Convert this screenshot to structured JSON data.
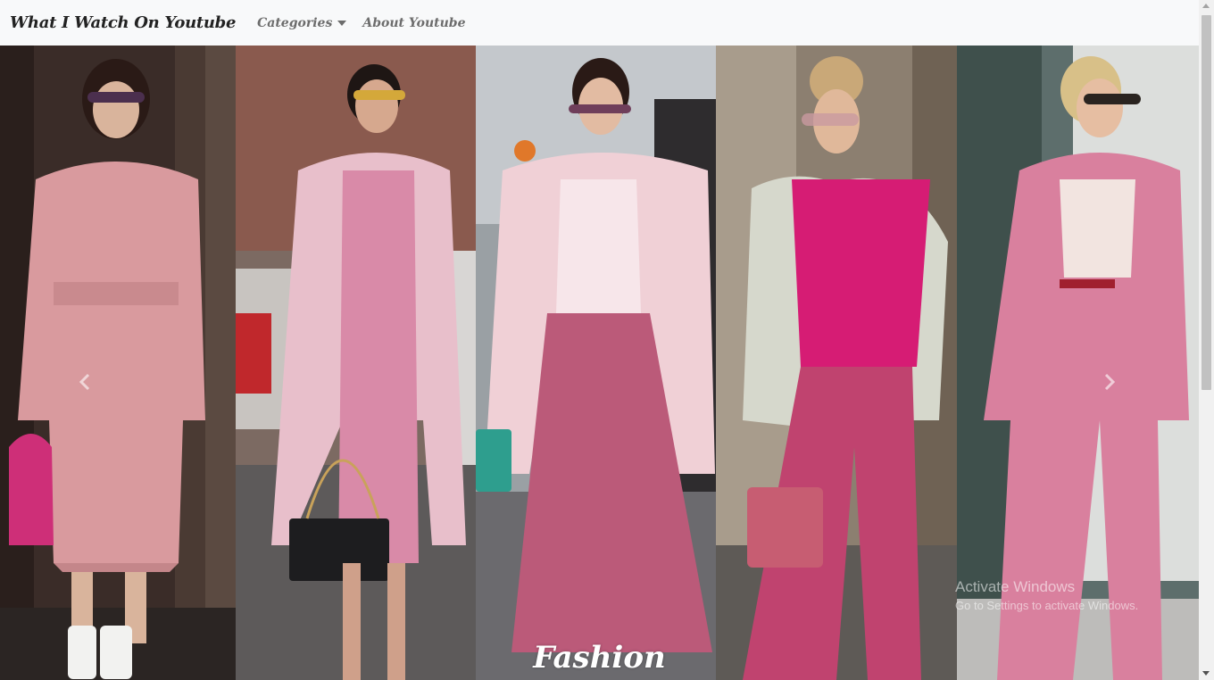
{
  "navbar": {
    "brand": "What I Watch On Youtube",
    "links": [
      {
        "label": "Categories",
        "dropdown": true
      },
      {
        "label": "About Youtube",
        "dropdown": false
      }
    ]
  },
  "carousel": {
    "caption": "Fashion",
    "slides": [
      {
        "name": "pink-shirt-dress-look",
        "colors": {
          "bg": "#3e2f2a",
          "outfit": "#d99a9e",
          "accent": "#ce2f78"
        }
      },
      {
        "name": "pink-coat-dress-look",
        "colors": {
          "bg": "#7d6d66",
          "outfit": "#e8b8c6",
          "accent": "#1d1d1f"
        }
      },
      {
        "name": "pink-fleece-coat-pleated-skirt-look",
        "colors": {
          "bg": "#9aa2a6",
          "outfit": "#bb5a79",
          "accent": "#2e9e8e"
        }
      },
      {
        "name": "magenta-top-denim-jacket-look",
        "colors": {
          "bg": "#8a7d6e",
          "outfit": "#c0436f",
          "accent": "#d61c74"
        }
      },
      {
        "name": "pink-plaid-suit-look",
        "colors": {
          "bg": "#5f7370",
          "outfit": "#d9809e",
          "accent": "#f2e4e0"
        }
      }
    ]
  },
  "watermark": {
    "title": "Activate Windows",
    "subtitle": "Go to Settings to activate Windows."
  }
}
